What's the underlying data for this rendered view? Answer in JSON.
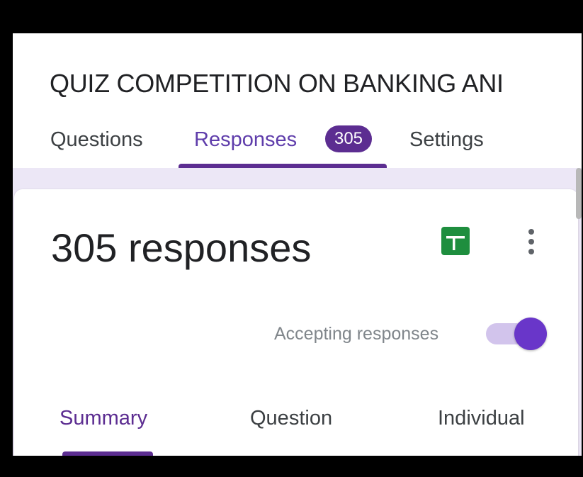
{
  "form": {
    "title": "QUIZ COMPETITION ON BANKING ANI"
  },
  "tabs": {
    "questions": "Questions",
    "responses": "Responses",
    "responses_count": "305",
    "settings": "Settings",
    "active": "responses"
  },
  "summary": {
    "response_count": "305 responses",
    "accepting_label": "Accepting responses",
    "accepting": true
  },
  "subtabs": {
    "summary": "Summary",
    "question": "Question",
    "individual": "Individual",
    "active": "summary"
  },
  "icons": {
    "sheets": "google-sheets-icon",
    "more": "more-vert-icon"
  },
  "colors": {
    "accent": "#5c2d91",
    "toggle_thumb": "#6936c9",
    "toggle_track": "#d2c4ec",
    "band": "#ece7f6",
    "sheets_green": "#1e8e3e"
  }
}
